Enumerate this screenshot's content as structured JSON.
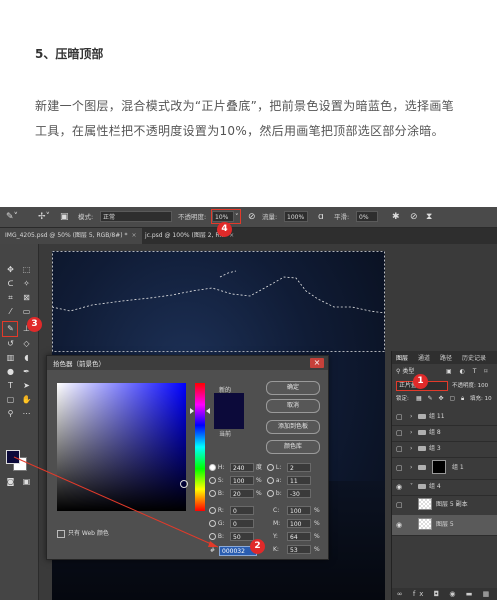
{
  "article": {
    "heading": "5、压暗顶部",
    "paragraph": "新建一个图层，混合模式改为“正片叠底”，把前景色设置为暗蓝色，选择画笔工具，在属性栏把不透明度设置为10%，然后用画笔把顶部选区部分涂暗。"
  },
  "options_bar": {
    "mode_label": "模式:",
    "mode_value": "正常",
    "opacity_label": "不透明度:",
    "opacity_value": "10%",
    "flow_label": "流量:",
    "flow_value": "100%",
    "smooth_label": "平滑:",
    "smooth_value": "0%"
  },
  "tabs": [
    {
      "label": "IMG_4205.psd @ 50% (图层 5, RGB/8#) *",
      "close": "×"
    },
    {
      "label": "jc.psd @ 100% (图层 2, R...",
      "close": "×"
    }
  ],
  "color_picker": {
    "title": "拾色器（前景色）",
    "close": "×",
    "new_label": "新的",
    "current_label": "当前",
    "buttons": [
      "确定",
      "取消",
      "添加到色板",
      "颜色库"
    ],
    "web_only": "只有 Web 颜色",
    "fields": {
      "H": "240",
      "H_unit": "度",
      "S": "100",
      "S_unit": "%",
      "B": "20",
      "B_unit": "%",
      "R": "0",
      "G": "0",
      "B2": "50",
      "L": "2",
      "a": "11",
      "b": "-30",
      "C": "100",
      "C_unit": "%",
      "M": "100",
      "M_unit": "%",
      "Y": "64",
      "Y_unit": "%",
      "K": "53",
      "K_unit": "%"
    },
    "hex_label": "#",
    "hex": "000032"
  },
  "layers_panel": {
    "tabs": [
      "图层",
      "通道",
      "路径",
      "历史记录"
    ],
    "filter": "类型",
    "blend_mode": "正片叠底",
    "opacity_label": "不透明度: 100",
    "lock_label": "锁定:",
    "fill_label": "填充: 10",
    "rows": [
      {
        "name": "组 11",
        "type": "group"
      },
      {
        "name": "组 8",
        "type": "group"
      },
      {
        "name": "组 3",
        "type": "group"
      },
      {
        "name": "组 1",
        "type": "group-mask"
      },
      {
        "name": "组 4",
        "type": "group-open"
      },
      {
        "name": "图层 5 副本",
        "type": "layer"
      },
      {
        "name": "图层 5",
        "type": "layer"
      }
    ],
    "bottom_icons": "∞ fx ◘ ◉ ▬ ▦"
  },
  "badges": [
    "1",
    "2",
    "3",
    "4"
  ],
  "colors": {
    "accent_red": "#e23a2a",
    "foreground": "#0c0a3a",
    "highlight_underline": "#c6f24e"
  }
}
